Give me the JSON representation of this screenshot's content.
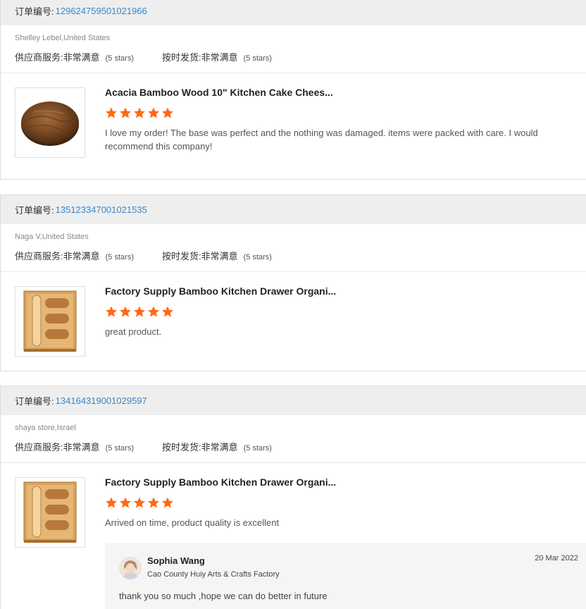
{
  "labels": {
    "order_no": "订单编号:",
    "supplier_service": "供应商服务:",
    "on_time_shipment": "按时发货:"
  },
  "colors": {
    "star": "#ff6a14",
    "order_link": "#3a86c8",
    "header_bg": "#eeeeee"
  },
  "reviews": [
    {
      "order_number": "129624759501021966",
      "buyer": "Shelley Lebel,United States",
      "supplier_rating": "非常满意",
      "supplier_stars": "(5 stars)",
      "shipment_rating": "非常满意",
      "shipment_stars": "(5 stars)",
      "product_icon": "round-cutting-board-image",
      "product_title": "Acacia Bamboo Wood 10\" Kitchen Cake Chees...",
      "star_count": 5,
      "text": "I love my order!  The base was perfect and the nothing was damaged. items were packed with care. I would recommend this company!"
    },
    {
      "order_number": "135123347001021535",
      "buyer": "Naga V,United States",
      "supplier_rating": "非常满意",
      "supplier_stars": "(5 stars)",
      "shipment_rating": "非常满意",
      "shipment_stars": "(5 stars)",
      "product_icon": "drawer-organizer-image",
      "product_title": "Factory Supply Bamboo Kitchen Drawer Organi...",
      "star_count": 5,
      "text": "great product."
    },
    {
      "order_number": "134164319001029597",
      "buyer": "shaya store,Israel",
      "supplier_rating": "非常满意",
      "supplier_stars": "(5 stars)",
      "shipment_rating": "非常满意",
      "shipment_stars": "(5 stars)",
      "product_icon": "drawer-organizer-image",
      "product_title": "Factory Supply Bamboo Kitchen Drawer Organi...",
      "star_count": 5,
      "text": "Arrived on time, product quality is excellent",
      "reply": {
        "name": "Sophia Wang",
        "company": "Cao County Huiy Arts & Crafts Factory",
        "date": "20 Mar 2022",
        "text": "thank you so much ,hope we can do better in future"
      }
    }
  ]
}
